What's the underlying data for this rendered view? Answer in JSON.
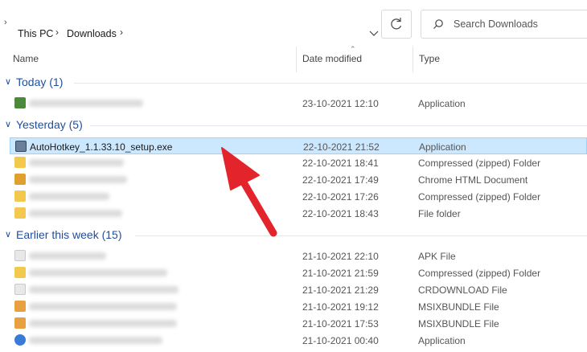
{
  "address_bar": {
    "breadcrumbs": [
      "This PC",
      "Downloads"
    ]
  },
  "search": {
    "placeholder": "Search Downloads"
  },
  "columns": {
    "name": "Name",
    "date": "Date modified",
    "type": "Type"
  },
  "groups": [
    {
      "label": "Today (1)",
      "rows": [
        {
          "name": "",
          "date": "23-10-2021 12:10",
          "type": "Application",
          "icon": "exe-icon",
          "color": "#4a8a3a"
        }
      ]
    },
    {
      "label": "Yesterday (5)",
      "rows": [
        {
          "name": "AutoHotkey_1.1.33.10_setup.exe",
          "date": "22-10-2021 21:52",
          "type": "Application",
          "icon": "autohotkey-icon",
          "color": "#6a7f99",
          "selected": true
        },
        {
          "name": "",
          "date": "22-10-2021 18:41",
          "type": "Compressed (zipped) Folder",
          "icon": "zip-folder-icon",
          "color": "#f2c94c"
        },
        {
          "name": "",
          "date": "22-10-2021 17:49",
          "type": "Chrome HTML Document",
          "icon": "chrome-icon",
          "color": "#e0a030"
        },
        {
          "name": "",
          "date": "22-10-2021 17:26",
          "type": "Compressed (zipped) Folder",
          "icon": "zip-folder-icon",
          "color": "#f2c94c"
        },
        {
          "name": "",
          "date": "22-10-2021 18:43",
          "type": "File folder",
          "icon": "folder-icon",
          "color": "#f2c94c"
        }
      ]
    },
    {
      "label": "Earlier this week (15)",
      "rows": [
        {
          "name": "",
          "date": "21-10-2021 22:10",
          "type": "APK File",
          "icon": "file-icon",
          "color": "#e8e8e8"
        },
        {
          "name": "",
          "date": "21-10-2021 21:59",
          "type": "Compressed (zipped) Folder",
          "icon": "zip-folder-icon",
          "color": "#f2c94c"
        },
        {
          "name": "",
          "date": "21-10-2021 21:29",
          "type": "CRDOWNLOAD File",
          "icon": "file-icon",
          "color": "#e8e8e8"
        },
        {
          "name": "",
          "date": "21-10-2021 19:12",
          "type": "MSIXBUNDLE File",
          "icon": "package-icon",
          "color": "#e8a040"
        },
        {
          "name": "",
          "date": "21-10-2021 17:53",
          "type": "MSIXBUNDLE File",
          "icon": "package-icon",
          "color": "#e8a040"
        },
        {
          "name": "",
          "date": "21-10-2021 00:40",
          "type": "Application",
          "icon": "exe-icon",
          "color": "#3a7bd5"
        }
      ]
    }
  ],
  "colors": {
    "group_text": "#1f4e9e",
    "selection_bg": "#cce8ff",
    "selection_border": "#99d1ff",
    "arrow": "#e3242b"
  }
}
